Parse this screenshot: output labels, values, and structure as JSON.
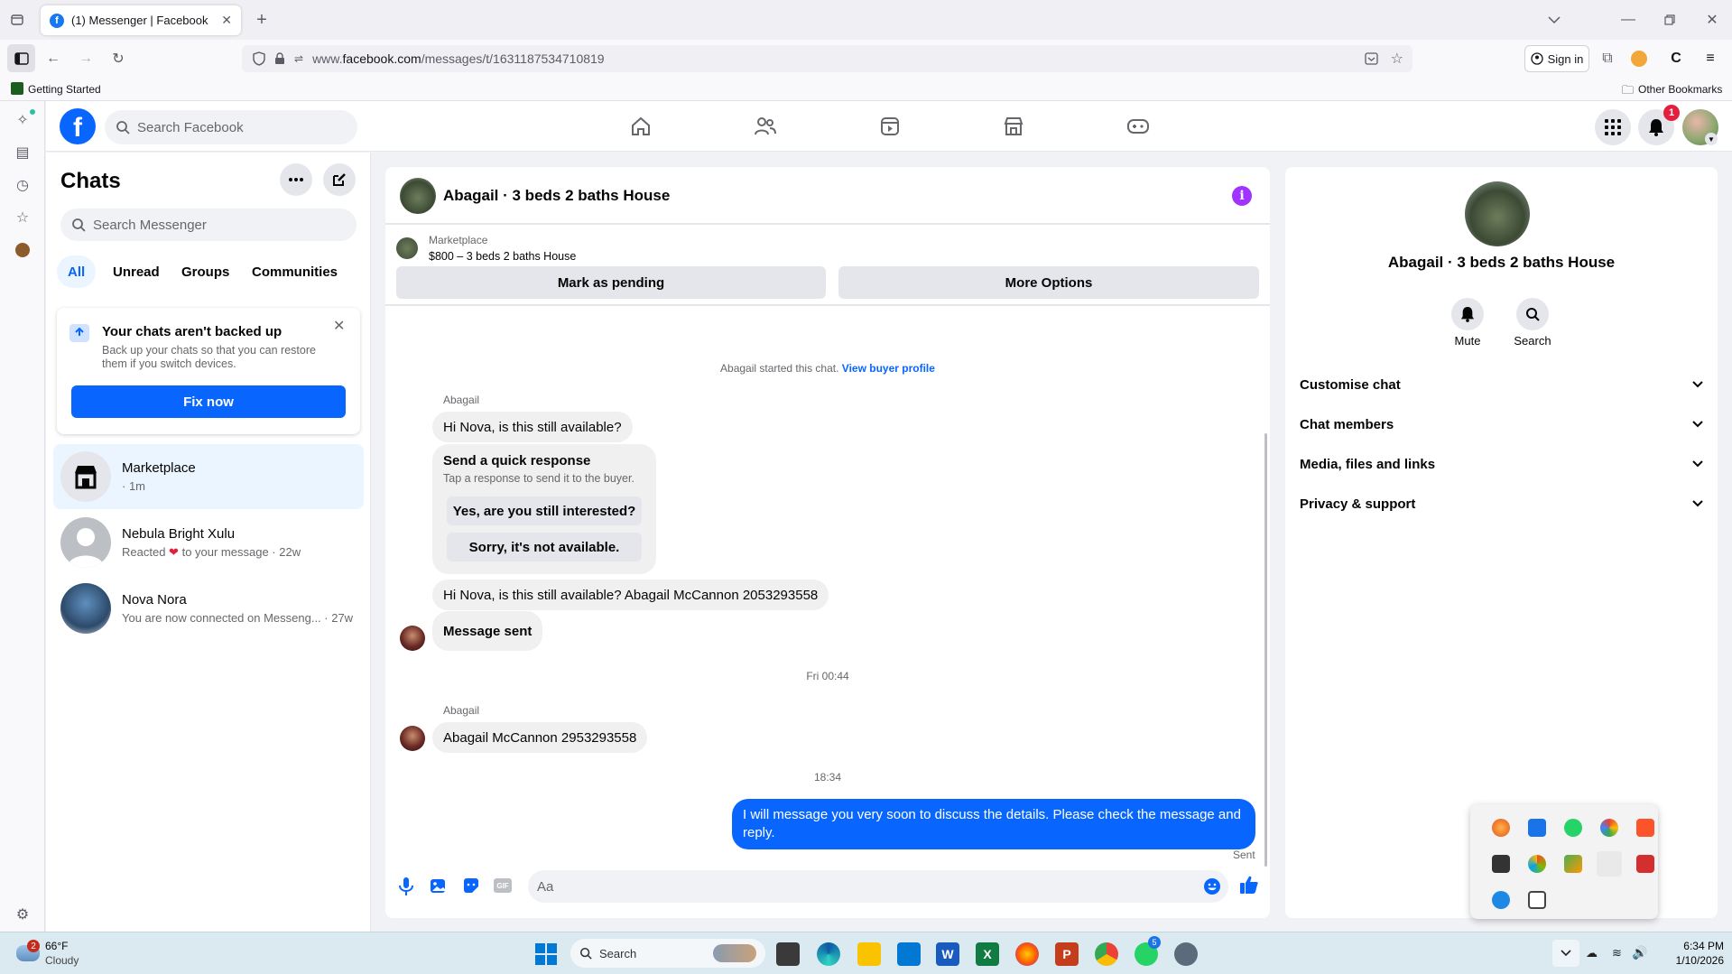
{
  "browser": {
    "tab_title": "(1) Messenger | Facebook",
    "url_prefix": "www.",
    "url_host": "facebook.com",
    "url_path": "/messages/t/1631187534710819",
    "sign_in": "Sign in",
    "bookmark_getting_started": "Getting Started",
    "bookmark_other": "Other Bookmarks"
  },
  "facebook": {
    "search_placeholder": "Search Facebook",
    "notification_count": "1"
  },
  "chats": {
    "title": "Chats",
    "search_placeholder": "Search Messenger",
    "filters": [
      "All",
      "Unread",
      "Groups",
      "Communities"
    ],
    "backup": {
      "title": "Your chats aren't backed up",
      "body": "Back up your chats so that you can restore them if you switch devices.",
      "button": "Fix now"
    },
    "list": [
      {
        "name": "Marketplace",
        "sub": "· 1m"
      },
      {
        "name": "Nebula Bright Xulu",
        "sub_pre": "Reacted",
        "sub_post": "to your message · 22w"
      },
      {
        "name": "Nova Nora",
        "sub": "You are now connected on Messeng... · 27w"
      }
    ]
  },
  "conversation": {
    "title": "Abagail · 3 beds 2 baths House",
    "marketplace_label": "Marketplace",
    "listing": "$800 – 3 beds 2 baths House",
    "mark_pending": "Mark as pending",
    "more_options": "More Options",
    "started_text": "Abagail started this chat.",
    "view_profile": "View buyer profile",
    "sender_name": "Abagail",
    "msg1": "Hi Nova, is this still available?",
    "quick_title": "Send a quick response",
    "quick_sub": "Tap a response to send it to the buyer.",
    "quick_1": "Yes, are you still interested?",
    "quick_2": "Sorry, it's not available.",
    "msg2": "Hi Nova, is this still available? Abagail McCannon 2053293558",
    "msg3": "Message sent",
    "time1": "Fri 00:44",
    "msg4": "Abagail McCannon 2953293558",
    "time2": "18:34",
    "my_msg": "I will message you very soon to discuss the details. Please check the message and reply.",
    "sent_status": "Sent",
    "composer_placeholder": "Aa"
  },
  "info_panel": {
    "title": "Abagail · 3 beds 2 baths House",
    "mute": "Mute",
    "search": "Search",
    "sections": [
      "Customise chat",
      "Chat members",
      "Media, files and links",
      "Privacy & support"
    ]
  },
  "taskbar": {
    "temp": "66°F",
    "weather": "Cloudy",
    "weather_badge": "2",
    "search": "Search",
    "time": "6:34 PM",
    "date": "1/10/2026",
    "whatsapp_badge": "5"
  },
  "colors": {
    "fb_blue": "#0866ff",
    "bubble_grey": "#f0f0f0",
    "accent_purple": "#a033ff"
  }
}
